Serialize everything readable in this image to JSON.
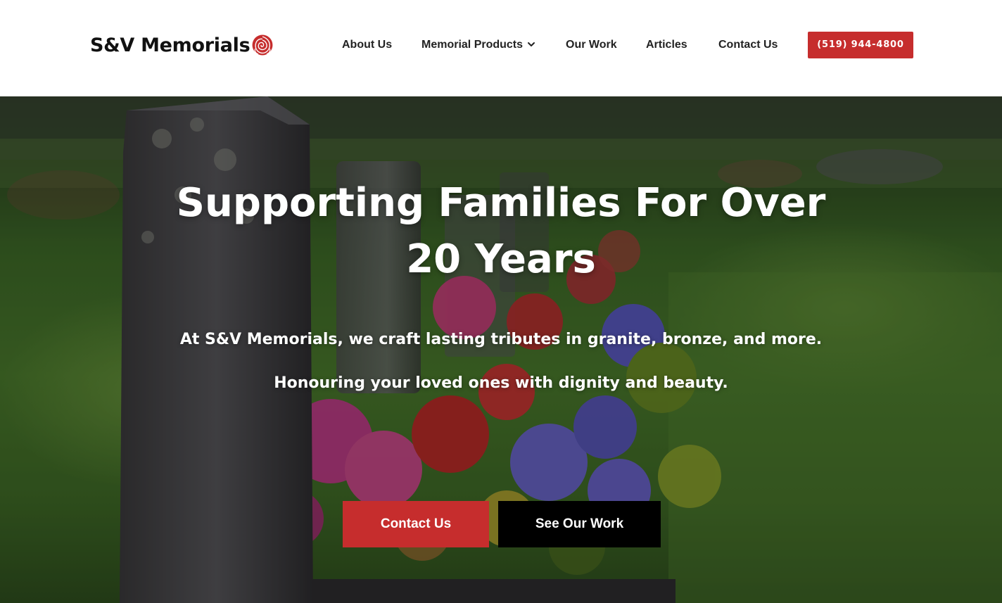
{
  "brand": {
    "name": "S&V Memorials",
    "accent_color": "#c62d2d",
    "logo_icon": "rose-icon"
  },
  "nav": {
    "items": [
      {
        "label": "About Us"
      },
      {
        "label": "Memorial Products",
        "icon": "chevron-down-icon"
      },
      {
        "label": "Our Work"
      },
      {
        "label": "Articles"
      },
      {
        "label": "Contact Us"
      }
    ],
    "phone_label": "(519) 944-4800"
  },
  "hero": {
    "title": "Supporting Families For Over 20 Years",
    "subtitle_1": "At S&V Memorials, we craft lasting tributes in granite, bronze, and more.",
    "subtitle_2": "Honouring your loved ones with dignity and beauty.",
    "primary_button": "Contact Us",
    "secondary_button": "See Our Work",
    "primary_color": "#c62d2d",
    "secondary_color": "#000000"
  }
}
